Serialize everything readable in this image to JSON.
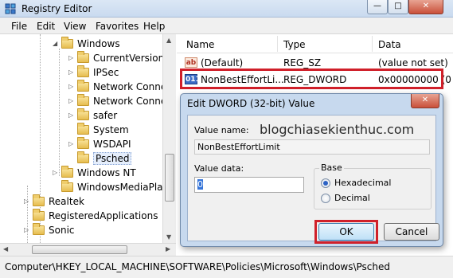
{
  "window": {
    "title": "Registry Editor",
    "minimize_label": "—",
    "maximize_label": "□",
    "close_label": "✕"
  },
  "menu": [
    "File",
    "Edit",
    "View",
    "Favorites",
    "Help"
  ],
  "tree": {
    "items": [
      {
        "label": "Windows",
        "arrow": "◢"
      },
      {
        "label": "CurrentVersion",
        "arrow": "▷"
      },
      {
        "label": "IPSec",
        "arrow": "▷"
      },
      {
        "label": "Network Conne",
        "arrow": "▷"
      },
      {
        "label": "Network Connec",
        "arrow": "▷"
      },
      {
        "label": "safer",
        "arrow": "▷"
      },
      {
        "label": "System",
        "arrow": ""
      },
      {
        "label": "WSDAPI",
        "arrow": "▷"
      },
      {
        "label": "Psched",
        "arrow": ""
      },
      {
        "label": "Windows NT",
        "arrow": "▷"
      },
      {
        "label": "WindowsMediaPlay",
        "arrow": ""
      },
      {
        "label": "Realtek",
        "arrow": "▷"
      },
      {
        "label": "RegisteredApplications",
        "arrow": ""
      },
      {
        "label": "Sonic",
        "arrow": "▷"
      }
    ],
    "selected_index": 8
  },
  "list": {
    "columns": [
      "Name",
      "Type",
      "Data"
    ],
    "rows": [
      {
        "icon": "ab",
        "name": "(Default)",
        "type": "REG_SZ",
        "data": "(value not set)"
      },
      {
        "icon": "011",
        "name": "NonBestEffortLi...",
        "type": "REG_DWORD",
        "data": "0x00000000 (0"
      }
    ]
  },
  "status": {
    "path": "Computer\\HKEY_LOCAL_MACHINE\\SOFTWARE\\Policies\\Microsoft\\Windows\\Psched"
  },
  "dialog": {
    "title": "Edit DWORD (32-bit) Value",
    "close_label": "✕",
    "value_name_label": "Value name:",
    "value_name": "NonBestEffortLimit",
    "value_data_label": "Value data:",
    "value_data": "0",
    "base_label": "Base",
    "base_options": [
      "Hexadecimal",
      "Decimal"
    ],
    "base_selected": "Hexadecimal",
    "ok_label": "OK",
    "cancel_label": "Cancel"
  },
  "watermark": "blogchiasekienthuc.com",
  "colors": {
    "highlight": "#d0202a",
    "selection": "#e5eefc"
  }
}
